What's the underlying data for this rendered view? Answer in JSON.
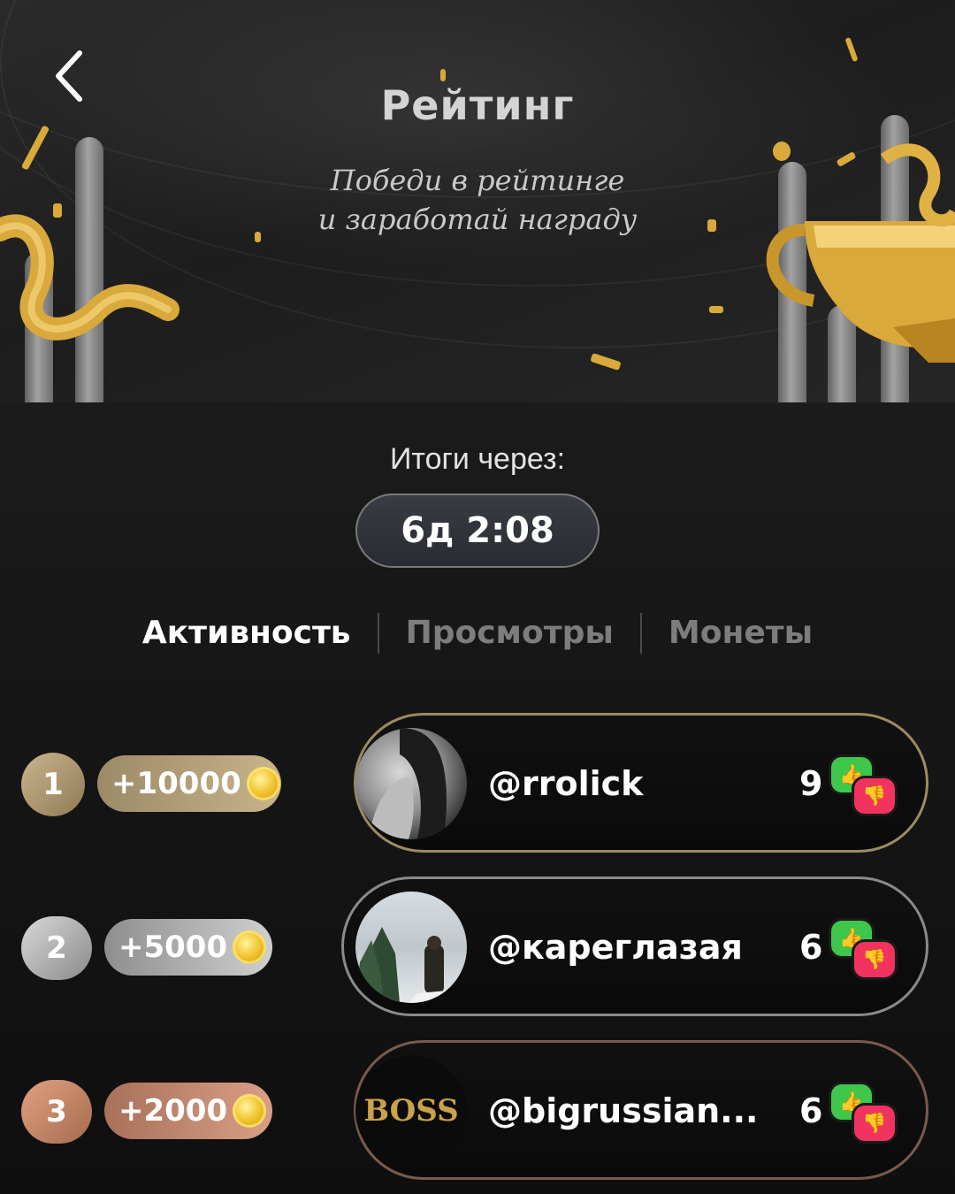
{
  "header": {
    "title": "Рейтинг",
    "subtitle_line1": "Победи в рейтинге",
    "subtitle_line2": "и заработай награду"
  },
  "countdown": {
    "label": "Итоги через:",
    "value": "6д 2:08"
  },
  "tabs": [
    {
      "label": "Активность",
      "active": true
    },
    {
      "label": "Просмотры",
      "active": false
    },
    {
      "label": "Монеты",
      "active": false
    }
  ],
  "leaderboard": [
    {
      "rank": "1",
      "reward": "+10000",
      "username": "@rrolick",
      "score": "9",
      "rank_color": "#b8a27a"
    },
    {
      "rank": "2",
      "reward": "+5000",
      "username": "@кареглазая",
      "score": "6",
      "rank_color": "#bcbcbc"
    },
    {
      "rank": "3",
      "reward": "+2000",
      "username": "@bigrussian...",
      "score": "6",
      "rank_color": "#c9876a"
    }
  ],
  "avatar_text": {
    "boss": "BOSS"
  },
  "icons": {
    "back": "chevron-left-icon",
    "coin": "coin-icon",
    "like": "thumbs-up-icon",
    "dislike": "thumbs-down-icon",
    "trophy": "trophy-icon"
  },
  "colors": {
    "gold": "#d9a93b",
    "like": "#3fc74b",
    "dislike": "#f2335f"
  }
}
